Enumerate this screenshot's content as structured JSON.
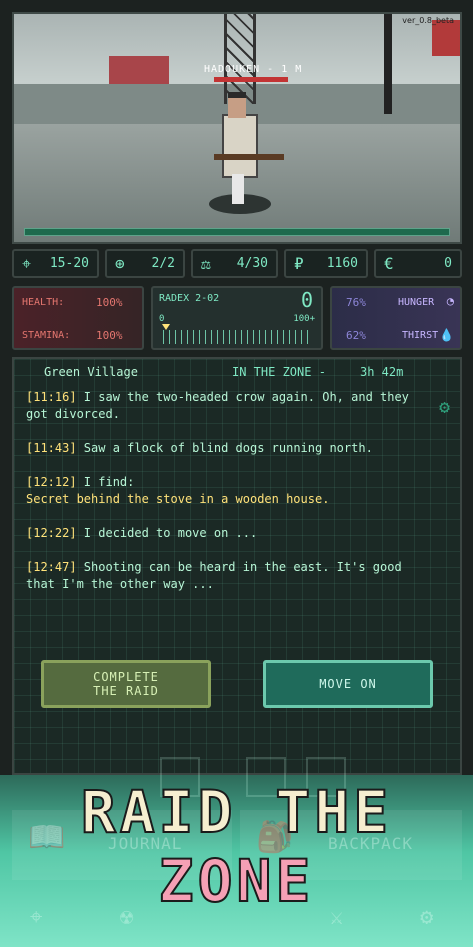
{
  "version": "ver_0.8_beta",
  "enemy": {
    "name": "HADOUKEN - 1 M",
    "hp_fraction": 1.0
  },
  "stats": [
    {
      "icon": "crosshair-icon",
      "glyph": "⌖",
      "value": "15-20"
    },
    {
      "icon": "target-icon",
      "glyph": "⊕",
      "value": "2/2"
    },
    {
      "icon": "weight-icon",
      "glyph": "⚖",
      "value": "4/30"
    },
    {
      "icon": "ruble-icon",
      "glyph": "₽",
      "value": "1160"
    },
    {
      "icon": "euro-icon",
      "glyph": "€",
      "value": "0"
    }
  ],
  "health": {
    "health_label": "HEALTH:",
    "health_value": "100%",
    "stamina_label": "STAMINA:",
    "stamina_value": "100%"
  },
  "radex": {
    "title": "RADEX 2-02",
    "reading": "0",
    "scale_min": "0",
    "scale_max": "100+",
    "level": 0
  },
  "needs": {
    "hunger_value": "76%",
    "hunger_label": "HUNGER",
    "thirst_value": "62%",
    "thirst_label": "THIRST"
  },
  "log": {
    "location": "Green Village",
    "status": "IN THE ZONE -",
    "timer": "3h 42m",
    "entries": [
      {
        "time": "[11:16]",
        "text": " I saw the two-headed crow again. Oh, and they got divorced."
      },
      {
        "time": "[11:43]",
        "text": " Saw a flock of blind dogs running north."
      },
      {
        "time": "[12:12]",
        "text": " I find:",
        "find": "Secret behind the stove in a wooden house."
      },
      {
        "time": "[12:22]",
        "text": " I decided to move on ..."
      },
      {
        "time": "[12:47]",
        "text": " Shooting can be heard in the east. It's good that I'm the other way ..."
      }
    ]
  },
  "buttons": {
    "complete": "COMPLETE\nTHE RAID",
    "move_on": "MOVE ON"
  },
  "bottom_nav": {
    "journal": "JOURNAL",
    "backpack": "BACKPACK"
  },
  "promo": {
    "line1": "RAID THE",
    "line2": "ZONE"
  },
  "colors": {
    "accent": "#7fe9c4",
    "time": "#ffe27a",
    "health": "#e4766f",
    "promo_pink": "#f5a0b5"
  }
}
